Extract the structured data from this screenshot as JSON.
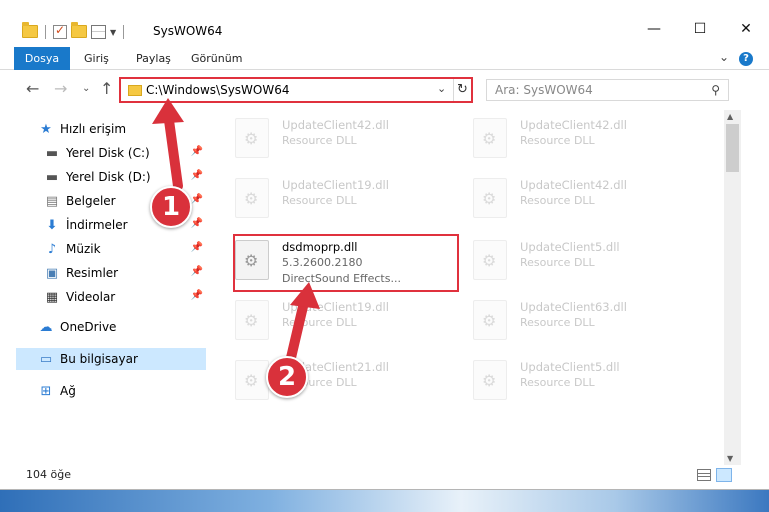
{
  "window": {
    "title": "SysWOW64",
    "controls": {
      "minimize": "—",
      "maximize": "☐",
      "close": "✕"
    }
  },
  "ribbon": {
    "tabs": [
      {
        "label": "Dosya",
        "active": true
      },
      {
        "label": "Giriş",
        "active": false
      },
      {
        "label": "Paylaş",
        "active": false
      },
      {
        "label": "Görünüm",
        "active": false
      }
    ],
    "help": "?"
  },
  "address": {
    "path": "C:\\Windows\\SysWOW64",
    "search_placeholder": "Ara: SysWOW64"
  },
  "sidebar": {
    "items": [
      {
        "label": "Hızlı erişim",
        "icon": "star-icon"
      },
      {
        "label": "Yerel Disk (C:)",
        "icon": "drive-icon",
        "pinned": true
      },
      {
        "label": "Yerel Disk (D:)",
        "icon": "drive-icon",
        "pinned": true
      },
      {
        "label": "Belgeler",
        "icon": "documents-icon",
        "pinned": true
      },
      {
        "label": "İndirmeler",
        "icon": "download-icon",
        "pinned": true
      },
      {
        "label": "Müzik",
        "icon": "music-icon",
        "pinned": true
      },
      {
        "label": "Resimler",
        "icon": "pictures-icon",
        "pinned": true
      },
      {
        "label": "Videolar",
        "icon": "video-icon",
        "pinned": true
      },
      {
        "label": "OneDrive",
        "icon": "cloud-icon"
      },
      {
        "label": "Bu bilgisayar",
        "icon": "computer-icon",
        "selected": true
      },
      {
        "label": "Ağ",
        "icon": "network-icon"
      }
    ]
  },
  "files": {
    "left": [
      {
        "name": "UpdateClient42.dll",
        "type": "Resource DLL"
      },
      {
        "name": "UpdateClient19.dll",
        "type": "Resource DLL"
      },
      {
        "name": "dsdmoprp.dll",
        "version": "5.3.2600.2180",
        "desc": "DirectSound Effects..."
      },
      {
        "name": "UpdateClient19.dll",
        "type": "Resource DLL"
      },
      {
        "name": "UpdateClient21.dll",
        "type": "Resource DLL"
      }
    ],
    "right": [
      {
        "name": "UpdateClient42.dll",
        "type": "Resource DLL"
      },
      {
        "name": "UpdateClient42.dll",
        "type": "Resource DLL"
      },
      {
        "name": "UpdateClient5.dll",
        "type": "Resource DLL"
      },
      {
        "name": "UpdateClient63.dll",
        "type": "Resource DLL"
      },
      {
        "name": "UpdateClient5.dll",
        "type": "Resource DLL"
      }
    ]
  },
  "status": {
    "count": "104 öğe"
  },
  "annotations": {
    "step1": "1",
    "step2": "2"
  },
  "colors": {
    "accent": "#1979ca",
    "highlight": "#e0313d",
    "selected": "#cce8ff"
  }
}
